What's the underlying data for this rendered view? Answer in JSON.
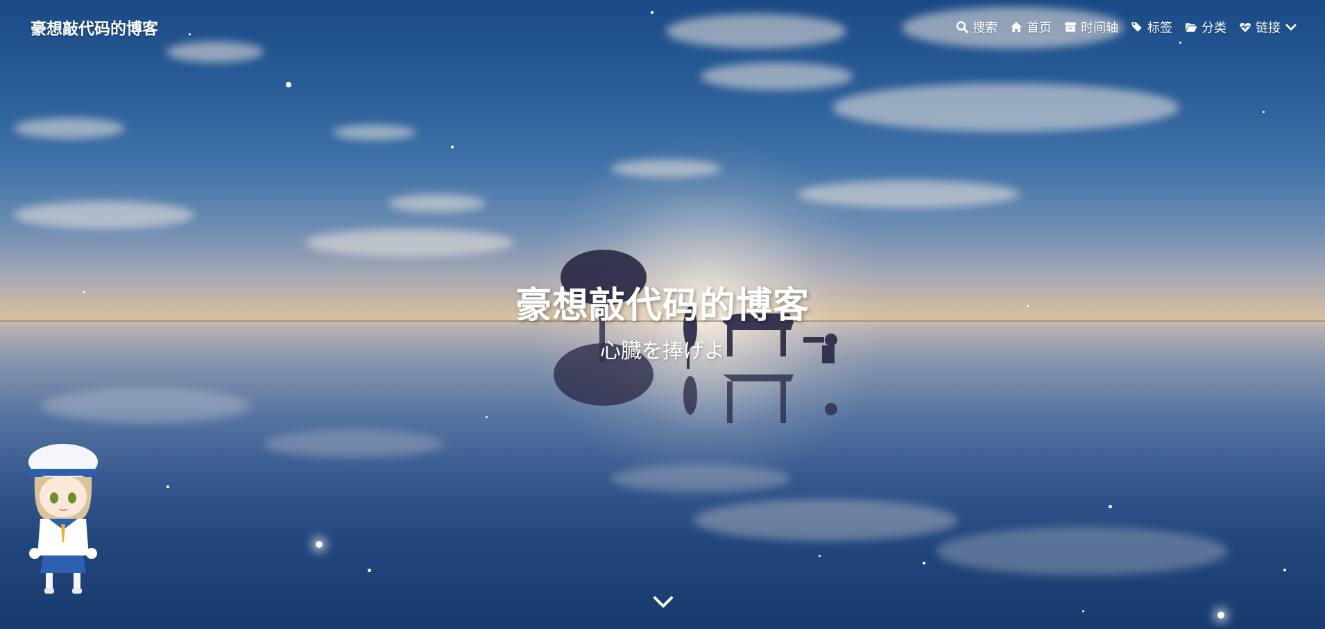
{
  "brand": {
    "title": "豪想敲代码的博客"
  },
  "menu": {
    "items": [
      {
        "label": "搜索",
        "icon": "search-icon"
      },
      {
        "label": "首页",
        "icon": "home-icon"
      },
      {
        "label": "时间轴",
        "icon": "archive-icon"
      },
      {
        "label": "标签",
        "icon": "tags-icon"
      },
      {
        "label": "分类",
        "icon": "folder-open-icon"
      },
      {
        "label": "链接",
        "icon": "heartbeat-icon",
        "dropdown_icon": "chevron-down-icon"
      }
    ]
  },
  "hero": {
    "title": "豪想敲代码的博客",
    "subtitle": "心臓を捧げよ"
  },
  "colors": {
    "sky_top": "#1a4a86",
    "horizon": "#d7c0a0",
    "text": "#ffffff"
  }
}
